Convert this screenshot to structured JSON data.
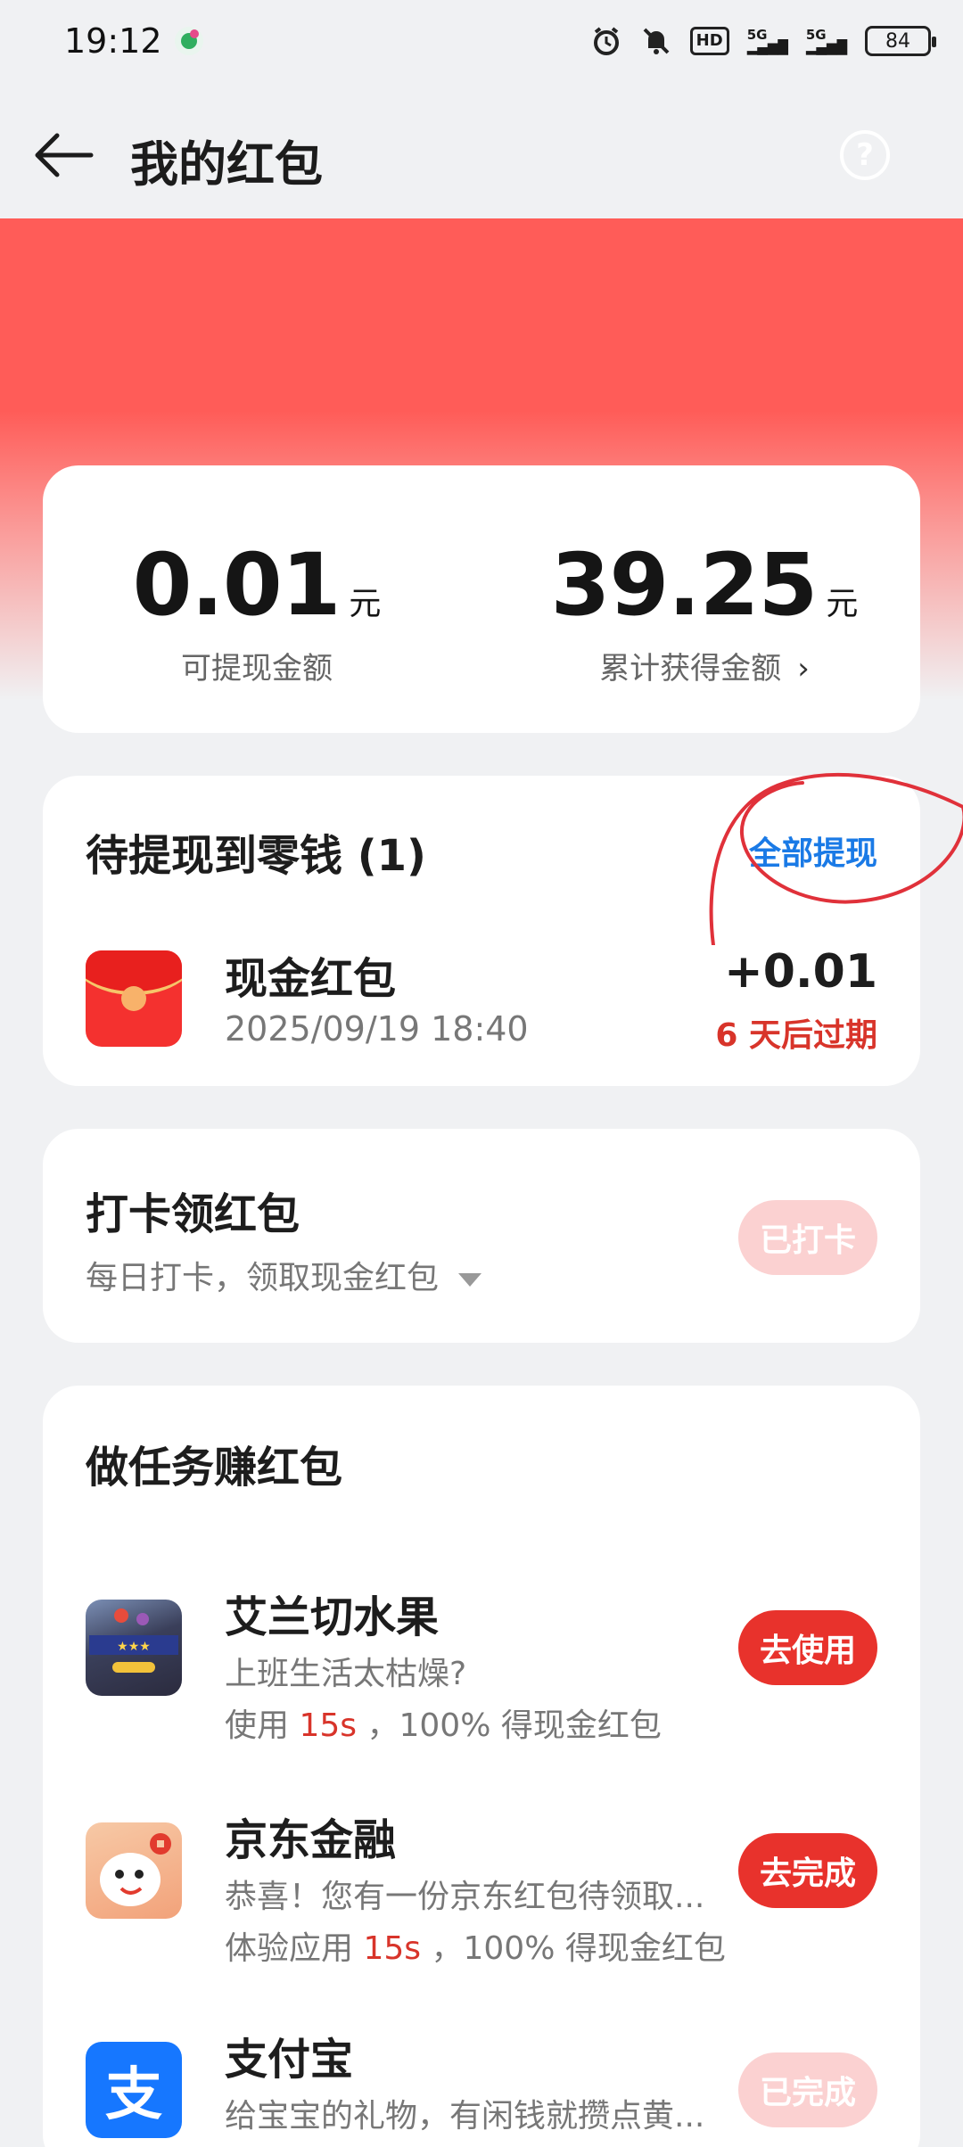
{
  "status_bar": {
    "time": "19:12",
    "battery": "84",
    "hd": "HD",
    "signal1": "5G",
    "signal2": "5G"
  },
  "header": {
    "title": "我的红包",
    "help": "?"
  },
  "balance": {
    "withdrawable_amount": "0.01",
    "withdrawable_unit": "元",
    "withdrawable_label": "可提现金额",
    "total_amount": "39.25",
    "total_unit": "元",
    "total_label": "累计获得金额",
    "chevron": "›"
  },
  "pending": {
    "title": "待提现到零钱 (1)",
    "withdraw_all": "全部提现",
    "item": {
      "name": "现金红包",
      "time": "2025/09/19 18:40",
      "amount": "+0.01",
      "expire": "6 天后过期"
    }
  },
  "checkin": {
    "title": "打卡领红包",
    "subtitle": "每日打卡，领取现金红包",
    "button": "已打卡"
  },
  "tasks": {
    "heading": "做任务赚红包",
    "items": [
      {
        "name": "艾兰切水果",
        "desc": "上班生活太枯燥?",
        "meta_prefix": "使用",
        "meta_highlight": "15s",
        "meta_suffix": "，100% 得现金红包",
        "button": "去使用",
        "icon": "fruit-game-icon"
      },
      {
        "name": "京东金融",
        "desc": "恭喜！您有一份京东红包待领取...",
        "meta_prefix": "体验应用",
        "meta_highlight": "15s",
        "meta_suffix": "，100% 得现金红包",
        "button": "去完成",
        "icon": "jd-finance-icon"
      },
      {
        "name": "支付宝",
        "desc": "给宝宝的礼物，有闲钱就攒点黄...",
        "button": "已完成",
        "icon": "alipay-icon",
        "icon_glyph": "支"
      }
    ]
  },
  "colors": {
    "accent_red": "#e8322c",
    "link_blue": "#1a7ae6",
    "banner_red": "#ff5c58"
  }
}
